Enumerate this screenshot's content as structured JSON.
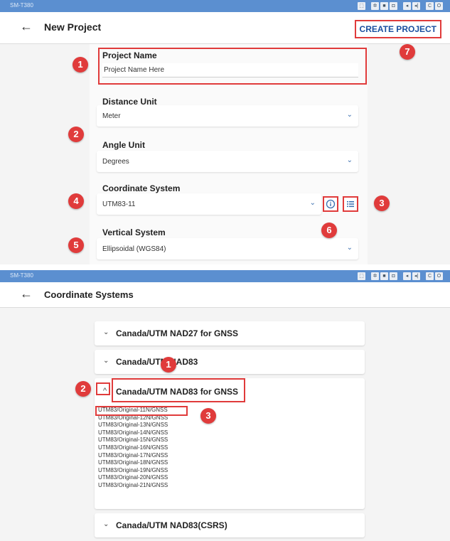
{
  "top": {
    "device": "SM-T380",
    "status_controls": [
      "⬚",
      "✲",
      "■",
      "◘",
      "◂",
      "◂|",
      "C",
      "O"
    ],
    "back_icon": "←",
    "title": "New Project",
    "create_button": "CREATE PROJECT",
    "project_name": {
      "label": "Project Name",
      "value": "Project Name Here"
    },
    "distance_unit": {
      "label": "Distance Unit",
      "value": "Meter"
    },
    "angle_unit": {
      "label": "Angle Unit",
      "value": "Degrees"
    },
    "coordinate_system": {
      "label": "Coordinate System",
      "value": "UTM83-11"
    },
    "vertical_system": {
      "label": "Vertical System",
      "value": "Ellipsoidal (WGS84)"
    },
    "chevron": "⌄",
    "badges": [
      "1",
      "2",
      "3",
      "4",
      "5",
      "6",
      "7"
    ]
  },
  "bottom": {
    "device": "SM-T380",
    "status_controls": [
      "⬚",
      "✲",
      "■",
      "◘",
      "◂",
      "◂|",
      "C",
      "O"
    ],
    "back_icon": "←",
    "title": "Coordinate Systems",
    "groups": [
      {
        "name": "Canada/UTM NAD27 for GNSS",
        "chevron": "⌄"
      },
      {
        "name": "Canada/UTM NAD83",
        "chevron": "⌄"
      },
      {
        "name": "Canada/UTM NAD83 for GNSS",
        "chevron": "^"
      },
      {
        "name": "Canada/UTM NAD83(CSRS)",
        "chevron": "⌄"
      }
    ],
    "expanded_items": [
      "UTM83/Original-11N/GNSS",
      "UTM83/Original-12N/GNSS",
      "UTM83/Original-13N/GNSS",
      "UTM83/Original-14N/GNSS",
      "UTM83/Original-15N/GNSS",
      "UTM83/Original-16N/GNSS",
      "UTM83/Original-17N/GNSS",
      "UTM83/Original-18N/GNSS",
      "UTM83/Original-19N/GNSS",
      "UTM83/Original-20N/GNSS",
      "UTM83/Original-21N/GNSS"
    ],
    "badges": [
      "1",
      "2",
      "3"
    ]
  },
  "colors": {
    "accent_red": "#e03b3b",
    "status_bar": "#5b8fd0",
    "link_blue": "#1a4fa0"
  }
}
